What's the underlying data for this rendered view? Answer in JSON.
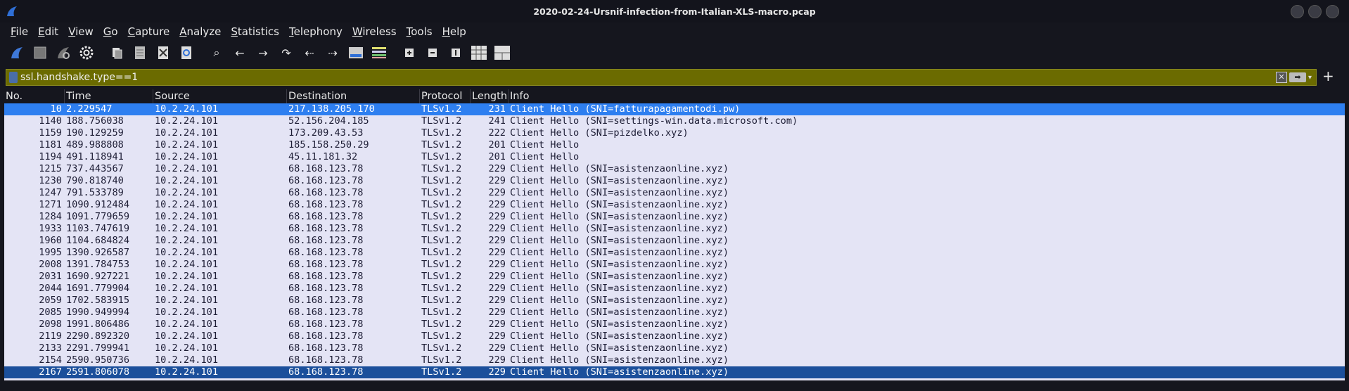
{
  "window": {
    "title": "2020-02-24-Ursnif-infection-from-Italian-XLS-macro.pcap"
  },
  "menu": [
    {
      "label": "File",
      "u": "F",
      "rest": "ile"
    },
    {
      "label": "Edit",
      "u": "E",
      "rest": "dit"
    },
    {
      "label": "View",
      "u": "V",
      "rest": "iew"
    },
    {
      "label": "Go",
      "u": "G",
      "rest": "o"
    },
    {
      "label": "Capture",
      "u": "C",
      "rest": "apture"
    },
    {
      "label": "Analyze",
      "u": "A",
      "rest": "nalyze"
    },
    {
      "label": "Statistics",
      "u": "S",
      "rest": "tatistics"
    },
    {
      "label": "Telephony",
      "u": "T",
      "rest": "elephony"
    },
    {
      "label": "Wireless",
      "u": "W",
      "rest": "ireless"
    },
    {
      "label": "Tools",
      "u": "T",
      "rest": "ools"
    },
    {
      "label": "Help",
      "u": "H",
      "rest": "elp"
    }
  ],
  "filter": {
    "value": "ssl.handshake.type==1"
  },
  "columns": {
    "no": "No.",
    "time": "Time",
    "source": "Source",
    "destination": "Destination",
    "protocol": "Protocol",
    "length": "Length",
    "info": "Info"
  },
  "packets": [
    {
      "no": "10",
      "time": "2.229547",
      "src": "10.2.24.101",
      "dst": "217.138.205.170",
      "proto": "TLSv1.2",
      "len": "231",
      "info": "Client Hello (SNI=fatturapagamentodi.pw)",
      "state": "sel1"
    },
    {
      "no": "1140",
      "time": "188.756038",
      "src": "10.2.24.101",
      "dst": "52.156.204.185",
      "proto": "TLSv1.2",
      "len": "241",
      "info": "Client Hello (SNI=settings-win.data.microsoft.com)",
      "state": ""
    },
    {
      "no": "1159",
      "time": "190.129259",
      "src": "10.2.24.101",
      "dst": "173.209.43.53",
      "proto": "TLSv1.2",
      "len": "222",
      "info": "Client Hello (SNI=pizdelko.xyz)",
      "state": ""
    },
    {
      "no": "1181",
      "time": "489.988808",
      "src": "10.2.24.101",
      "dst": "185.158.250.29",
      "proto": "TLSv1.2",
      "len": "201",
      "info": "Client Hello",
      "state": ""
    },
    {
      "no": "1194",
      "time": "491.118941",
      "src": "10.2.24.101",
      "dst": "45.11.181.32",
      "proto": "TLSv1.2",
      "len": "201",
      "info": "Client Hello",
      "state": ""
    },
    {
      "no": "1215",
      "time": "737.443567",
      "src": "10.2.24.101",
      "dst": "68.168.123.78",
      "proto": "TLSv1.2",
      "len": "229",
      "info": "Client Hello (SNI=asistenzaonline.xyz)",
      "state": ""
    },
    {
      "no": "1230",
      "time": "790.818740",
      "src": "10.2.24.101",
      "dst": "68.168.123.78",
      "proto": "TLSv1.2",
      "len": "229",
      "info": "Client Hello (SNI=asistenzaonline.xyz)",
      "state": ""
    },
    {
      "no": "1247",
      "time": "791.533789",
      "src": "10.2.24.101",
      "dst": "68.168.123.78",
      "proto": "TLSv1.2",
      "len": "229",
      "info": "Client Hello (SNI=asistenzaonline.xyz)",
      "state": ""
    },
    {
      "no": "1271",
      "time": "1090.912484",
      "src": "10.2.24.101",
      "dst": "68.168.123.78",
      "proto": "TLSv1.2",
      "len": "229",
      "info": "Client Hello (SNI=asistenzaonline.xyz)",
      "state": ""
    },
    {
      "no": "1284",
      "time": "1091.779659",
      "src": "10.2.24.101",
      "dst": "68.168.123.78",
      "proto": "TLSv1.2",
      "len": "229",
      "info": "Client Hello (SNI=asistenzaonline.xyz)",
      "state": ""
    },
    {
      "no": "1933",
      "time": "1103.747619",
      "src": "10.2.24.101",
      "dst": "68.168.123.78",
      "proto": "TLSv1.2",
      "len": "229",
      "info": "Client Hello (SNI=asistenzaonline.xyz)",
      "state": ""
    },
    {
      "no": "1960",
      "time": "1104.684824",
      "src": "10.2.24.101",
      "dst": "68.168.123.78",
      "proto": "TLSv1.2",
      "len": "229",
      "info": "Client Hello (SNI=asistenzaonline.xyz)",
      "state": ""
    },
    {
      "no": "1995",
      "time": "1390.926587",
      "src": "10.2.24.101",
      "dst": "68.168.123.78",
      "proto": "TLSv1.2",
      "len": "229",
      "info": "Client Hello (SNI=asistenzaonline.xyz)",
      "state": ""
    },
    {
      "no": "2008",
      "time": "1391.784753",
      "src": "10.2.24.101",
      "dst": "68.168.123.78",
      "proto": "TLSv1.2",
      "len": "229",
      "info": "Client Hello (SNI=asistenzaonline.xyz)",
      "state": ""
    },
    {
      "no": "2031",
      "time": "1690.927221",
      "src": "10.2.24.101",
      "dst": "68.168.123.78",
      "proto": "TLSv1.2",
      "len": "229",
      "info": "Client Hello (SNI=asistenzaonline.xyz)",
      "state": ""
    },
    {
      "no": "2044",
      "time": "1691.779904",
      "src": "10.2.24.101",
      "dst": "68.168.123.78",
      "proto": "TLSv1.2",
      "len": "229",
      "info": "Client Hello (SNI=asistenzaonline.xyz)",
      "state": ""
    },
    {
      "no": "2059",
      "time": "1702.583915",
      "src": "10.2.24.101",
      "dst": "68.168.123.78",
      "proto": "TLSv1.2",
      "len": "229",
      "info": "Client Hello (SNI=asistenzaonline.xyz)",
      "state": ""
    },
    {
      "no": "2085",
      "time": "1990.949994",
      "src": "10.2.24.101",
      "dst": "68.168.123.78",
      "proto": "TLSv1.2",
      "len": "229",
      "info": "Client Hello (SNI=asistenzaonline.xyz)",
      "state": ""
    },
    {
      "no": "2098",
      "time": "1991.806486",
      "src": "10.2.24.101",
      "dst": "68.168.123.78",
      "proto": "TLSv1.2",
      "len": "229",
      "info": "Client Hello (SNI=asistenzaonline.xyz)",
      "state": ""
    },
    {
      "no": "2119",
      "time": "2290.892320",
      "src": "10.2.24.101",
      "dst": "68.168.123.78",
      "proto": "TLSv1.2",
      "len": "229",
      "info": "Client Hello (SNI=asistenzaonline.xyz)",
      "state": ""
    },
    {
      "no": "2133",
      "time": "2291.799941",
      "src": "10.2.24.101",
      "dst": "68.168.123.78",
      "proto": "TLSv1.2",
      "len": "229",
      "info": "Client Hello (SNI=asistenzaonline.xyz)",
      "state": ""
    },
    {
      "no": "2154",
      "time": "2590.950736",
      "src": "10.2.24.101",
      "dst": "68.168.123.78",
      "proto": "TLSv1.2",
      "len": "229",
      "info": "Client Hello (SNI=asistenzaonline.xyz)",
      "state": ""
    },
    {
      "no": "2167",
      "time": "2591.806078",
      "src": "10.2.24.101",
      "dst": "68.168.123.78",
      "proto": "TLSv1.2",
      "len": "229",
      "info": "Client Hello (SNI=asistenzaonline.xyz)",
      "state": "sel2"
    }
  ],
  "colors": {
    "filter_bg": "#6b6b00",
    "row_bg": "#e4e4f5",
    "selected": "#2e7ff0",
    "selected_secondary": "#1b4f9b"
  }
}
